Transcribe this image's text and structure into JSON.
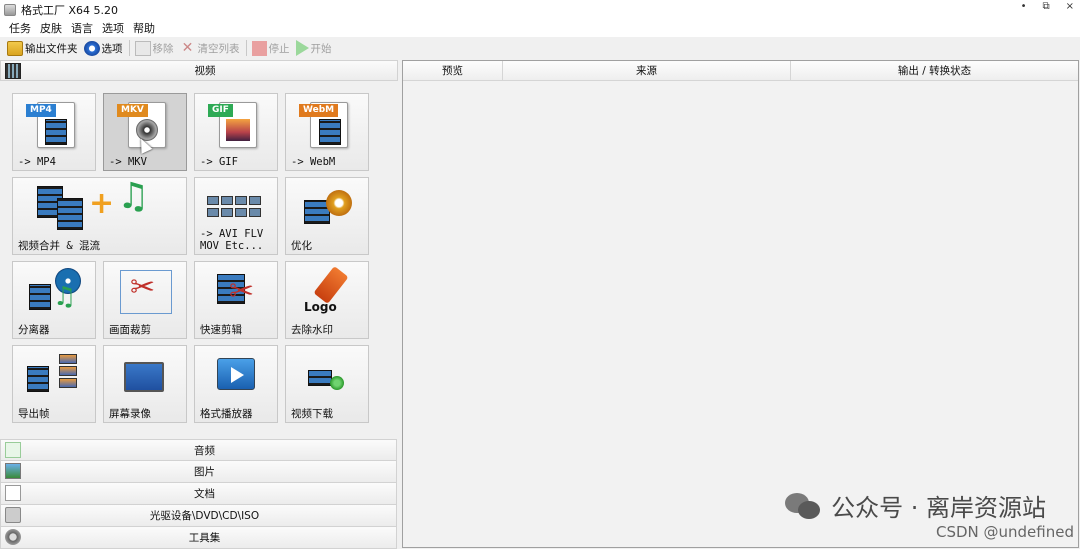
{
  "window": {
    "title": "格式工厂 X64 5.20",
    "controls": {
      "minimize": "•",
      "restore": "⧉",
      "close": "×"
    }
  },
  "menu": [
    "任务",
    "皮肤",
    "语言",
    "选项",
    "帮助"
  ],
  "toolbar": {
    "output_folder": "输出文件夹",
    "options": "选项",
    "remove": "移除",
    "clear_list": "清空列表",
    "stop": "停止",
    "start": "开始"
  },
  "categories": {
    "video": "视频",
    "audio": "音频",
    "image": "图片",
    "document": "文档",
    "disc": "光驱设备\\DVD\\CD\\ISO",
    "tools": "工具集"
  },
  "video_tiles": {
    "mp4": {
      "label": "-> MP4",
      "badge": "MP4",
      "badge_color": "#2b7fd1"
    },
    "mkv": {
      "label": "-> MKV",
      "badge": "MKV",
      "badge_color": "#e08a1e"
    },
    "gif": {
      "label": "-> GIF",
      "badge": "GIF",
      "badge_color": "#2eaa55"
    },
    "webm": {
      "label": "-> WebM",
      "badge": "WebM",
      "badge_color": "#e07a1e"
    },
    "merge": {
      "label": "视频合并 & 混流"
    },
    "avi": {
      "label": "-> AVI FLV\nMOV Etc..."
    },
    "optimize": {
      "label": "优化"
    },
    "splitter": {
      "label": "分离器"
    },
    "crop": {
      "label": "画面裁剪"
    },
    "quick_cut": {
      "label": "快速剪辑"
    },
    "remove_watermark": {
      "label": "去除水印",
      "logo": "Logo"
    },
    "export_frames": {
      "label": "导出帧"
    },
    "screen_record": {
      "label": "屏幕录像"
    },
    "player": {
      "label": "格式播放器"
    },
    "download": {
      "label": "视频下载"
    }
  },
  "task_table": {
    "columns": [
      "预览",
      "来源",
      "输出 / 转换状态"
    ]
  },
  "overlay": {
    "watermark": "公众号 · 离岸资源站",
    "credit": "CSDN @undefined"
  }
}
